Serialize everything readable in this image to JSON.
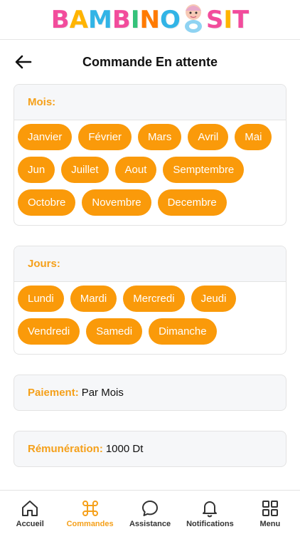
{
  "brand": {
    "letters": [
      "B",
      "A",
      "M",
      "B",
      "I",
      "N",
      "O",
      "S",
      "I",
      "T"
    ],
    "colors": [
      "#f24c9c",
      "#ffb400",
      "#32b4e6",
      "#f24c9c",
      "#34c27a",
      "#ff7a00",
      "#32b4e6",
      "#f24c9c",
      "#ffb400",
      "#f24c9c"
    ]
  },
  "header": {
    "title": "Commande En attente",
    "back_icon": "arrow-left-icon"
  },
  "months": {
    "label": "Mois:",
    "items": [
      "Janvier",
      "Février",
      "Mars",
      "Avril",
      "Mai",
      "Jun",
      "Juillet",
      "Aout",
      "Semptembre",
      "Octobre",
      "Novembre",
      "Decembre"
    ]
  },
  "days": {
    "label": "Jours:",
    "items": [
      "Lundi",
      "Mardi",
      "Mercredi",
      "Jeudi",
      "Vendredi",
      "Samedi",
      "Dimanche"
    ]
  },
  "payment": {
    "label": "Paiement:",
    "value": "Par Mois"
  },
  "remuneration": {
    "label": "Rémunération:",
    "value": "1000 Dt"
  },
  "tabs": [
    {
      "label": "Accueil",
      "icon": "home-icon"
    },
    {
      "label": "Commandes",
      "icon": "command-icon"
    },
    {
      "label": "Assistance",
      "icon": "chat-bubble-icon"
    },
    {
      "label": "Notifications",
      "icon": "bell-icon"
    },
    {
      "label": "Menu",
      "icon": "grid-icon"
    }
  ],
  "colors": {
    "accent": "#fa9a0a",
    "label": "#f5a01a"
  }
}
